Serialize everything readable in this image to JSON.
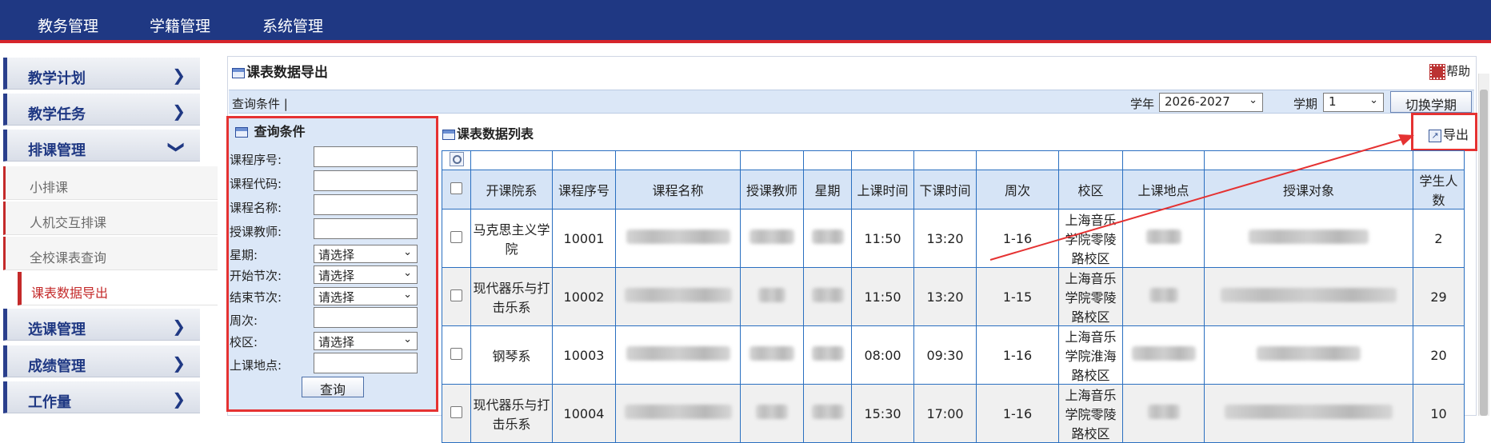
{
  "topnav": [
    "教务管理",
    "学籍管理",
    "系统管理"
  ],
  "sidebar": {
    "groups": [
      {
        "label": "教学计划",
        "chevron": "❯"
      },
      {
        "label": "教学任务",
        "chevron": "❯"
      },
      {
        "label": "排课管理",
        "chevron": "❯"
      },
      {
        "label": "选课管理",
        "chevron": "❯"
      },
      {
        "label": "成绩管理",
        "chevron": "❯"
      },
      {
        "label": "工作量",
        "chevron": "❯"
      }
    ],
    "sub_items": [
      "小排课",
      "人机交互排课",
      "全校课表查询",
      "课表数据导出"
    ]
  },
  "page": {
    "title": "课表数据导出",
    "help": "帮助"
  },
  "querybar": {
    "label": "查询条件 |",
    "year_label": "学年",
    "year_value": "2026-2027",
    "term_label": "学期",
    "term_value": "1",
    "switch_button": "切换学期"
  },
  "query": {
    "title": "查询条件",
    "fields": [
      {
        "label": "课程序号:",
        "value": ""
      },
      {
        "label": "课程代码:",
        "value": ""
      },
      {
        "label": "课程名称:",
        "value": ""
      },
      {
        "label": "授课教师:",
        "value": ""
      },
      {
        "label": "星期:",
        "value": "请选择"
      },
      {
        "label": "开始节次:",
        "value": "请选择"
      },
      {
        "label": "结束节次:",
        "value": "请选择"
      },
      {
        "label": "周次:",
        "value": ""
      },
      {
        "label": "校区:",
        "value": "请选择"
      },
      {
        "label": "上课地点:",
        "value": ""
      }
    ],
    "submit": "查询"
  },
  "list": {
    "title": "课表数据列表",
    "export": "导出",
    "headers": [
      "开课院系",
      "课程序号",
      "课程名称",
      "授课教师",
      "星期",
      "上课时间",
      "下课时间",
      "周次",
      "校区",
      "上课地点",
      "授课对象",
      "学生人数"
    ],
    "rows": [
      {
        "dept": "马克思主义学院",
        "seq": "10001",
        "start": "11:50",
        "end": "13:20",
        "weeks": "1-16",
        "campus": "上海音乐学院零陵路校区",
        "count": "2"
      },
      {
        "dept": "现代器乐与打击乐系",
        "seq": "10002",
        "start": "11:50",
        "end": "13:20",
        "weeks": "1-15",
        "campus": "上海音乐学院零陵路校区",
        "count": "29"
      },
      {
        "dept": "钢琴系",
        "seq": "10003",
        "start": "08:00",
        "end": "09:30",
        "weeks": "1-16",
        "campus": "上海音乐学院淮海路校区",
        "count": "20"
      },
      {
        "dept": "现代器乐与打击乐系",
        "seq": "10004",
        "start": "15:30",
        "end": "17:00",
        "weeks": "1-16",
        "campus": "上海音乐学院零陵路校区",
        "count": "10"
      }
    ]
  },
  "colors": {
    "nav": "#1f3883",
    "accent": "#d6252b",
    "highlight": "#e53232",
    "panel": "#dbe7f7",
    "grid_border": "#2a6fc0"
  },
  "icons": {
    "help": "help-icon",
    "title": "table-icon",
    "export": "export-icon",
    "search": "search-icon"
  }
}
